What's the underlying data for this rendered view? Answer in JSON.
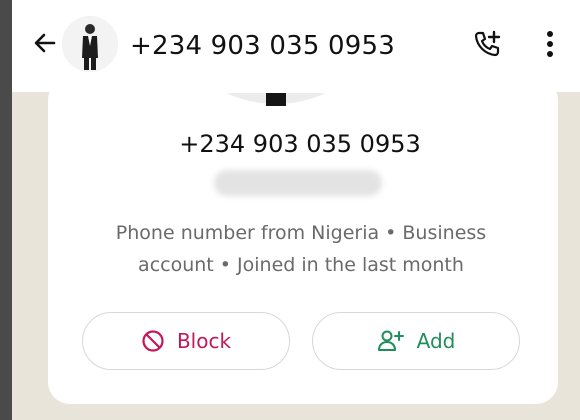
{
  "header": {
    "title": "+234 903 035 0953"
  },
  "profile": {
    "phone_number": "+234 903 035 0953",
    "meta_line1": "Phone number from Nigeria • Business",
    "meta_line2": "account • Joined in the last month"
  },
  "actions": {
    "block_label": "Block",
    "add_label": "Add"
  },
  "icons": {
    "back": "arrow-left-icon",
    "call": "call-add-icon",
    "menu": "more-vertical-icon",
    "block": "block-icon",
    "add": "add-contact-icon"
  },
  "colors": {
    "block_red": "#c2185b",
    "add_green": "#1e8e5a"
  }
}
